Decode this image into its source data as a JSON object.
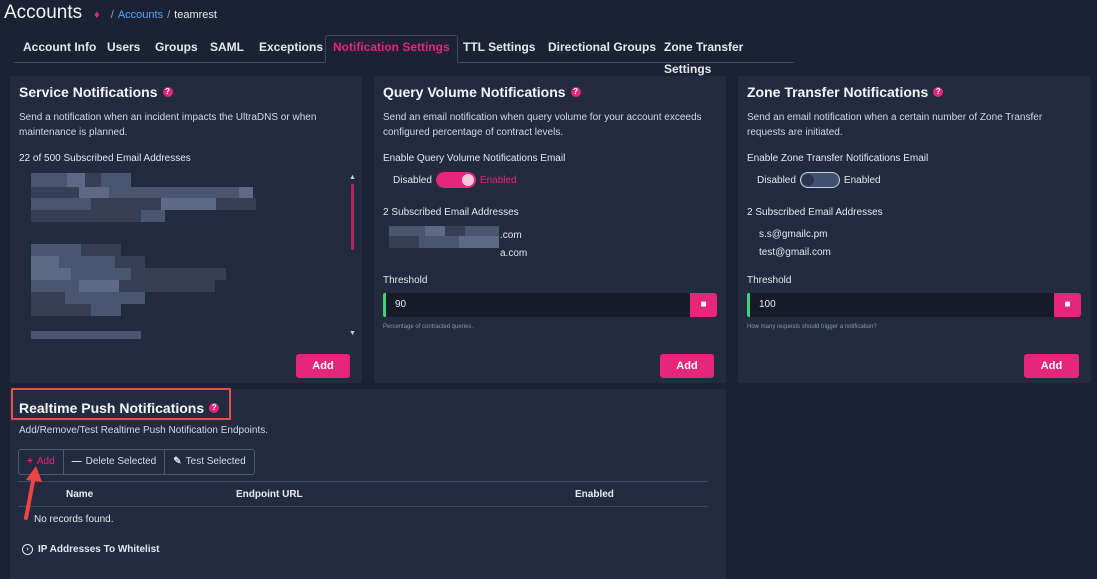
{
  "header": {
    "title": "Accounts",
    "breadcrumb": [
      "Accounts",
      "teamrest"
    ]
  },
  "tabs": [
    {
      "label": "Account Info",
      "active": false
    },
    {
      "label": "Users",
      "active": false
    },
    {
      "label": "Groups",
      "active": false
    },
    {
      "label": "SAML",
      "active": false
    },
    {
      "label": "Exceptions",
      "active": false
    },
    {
      "label": "Notification Settings",
      "active": true
    },
    {
      "label": "TTL Settings",
      "active": false
    },
    {
      "label": "Directional Groups",
      "active": false
    },
    {
      "label": "Zone Transfer Settings",
      "active": false
    }
  ],
  "service": {
    "title": "Service Notifications",
    "description": "Send a notification when an incident impacts the UltraDNS or when maintenance is planned.",
    "count_label": "22 of 500 Subscribed Email Addresses",
    "add_label": "Add"
  },
  "query": {
    "title": "Query Volume Notifications",
    "description": "Send an email notification when query volume for your account exceeds configured percentage of contract levels.",
    "enable_label": "Enable Query Volume Notifications Email",
    "toggle_off": "Disabled",
    "toggle_on": "Enabled",
    "enabled": true,
    "subscribed_label": "2 Subscribed Email Addresses",
    "emails": [
      ".com",
      "a.com"
    ],
    "threshold_label": "Threshold",
    "threshold_value": "90",
    "threshold_help": "Percentage of contracted queries.",
    "add_label": "Add"
  },
  "zone": {
    "title": "Zone Transfer Notifications",
    "description": "Send an email notification when a certain number of Zone Transfer requests are initiated.",
    "enable_label": "Enable Zone Transfer Notifications Email",
    "toggle_off": "Disabled",
    "toggle_on": "Enabled",
    "enabled": false,
    "subscribed_label": "2 Subscribed Email Addresses",
    "emails": [
      "s.s@gmailc.pm",
      "test@gmail.com"
    ],
    "threshold_label": "Threshold",
    "threshold_value": "100",
    "threshold_help": "How many requests should trigger a notification?",
    "add_label": "Add"
  },
  "realtime": {
    "title": "Realtime Push Notifications",
    "description": "Add/Remove/Test Realtime Push Notification Endpoints.",
    "buttons": {
      "add": "Add",
      "delete": "Delete Selected",
      "test": "Test Selected"
    },
    "columns": [
      "Name",
      "Endpoint URL",
      "Enabled"
    ],
    "empty": "No records found.",
    "whitelist_label": "IP Addresses To Whitelist"
  },
  "colors": {
    "accent": "#e6267a",
    "background": "#1b2233",
    "card": "#222b3f",
    "success": "#3bd671",
    "highlight": "#e94e4e"
  }
}
